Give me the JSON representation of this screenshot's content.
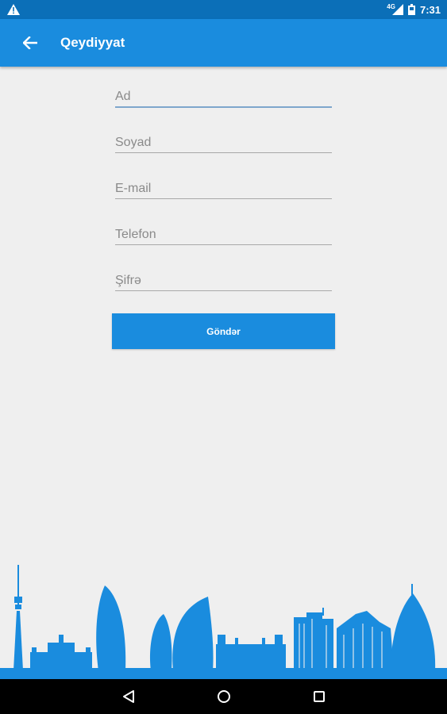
{
  "status_bar": {
    "time": "7:31",
    "network": "4G",
    "icons": [
      "warning-icon",
      "signal-icon",
      "battery-icon"
    ]
  },
  "app_bar": {
    "title": "Qeydiyyat",
    "back_icon": "arrow-left-icon"
  },
  "form": {
    "fields": [
      {
        "name": "first-name",
        "placeholder": "Ad",
        "value": ""
      },
      {
        "name": "last-name",
        "placeholder": "Soyad",
        "value": ""
      },
      {
        "name": "email",
        "placeholder": "E-mail",
        "value": ""
      },
      {
        "name": "phone",
        "placeholder": "Telefon",
        "value": ""
      },
      {
        "name": "password",
        "placeholder": "Şifrə",
        "value": ""
      }
    ],
    "submit_label": "Göndər"
  },
  "nav_bar": {
    "icons": [
      "back-triangle-icon",
      "home-circle-icon",
      "recents-square-icon"
    ]
  },
  "colors": {
    "primary": "#1a8cde",
    "status_bar": "#0b6fb8",
    "background": "#efefef",
    "skyline": "#1a8cde"
  }
}
